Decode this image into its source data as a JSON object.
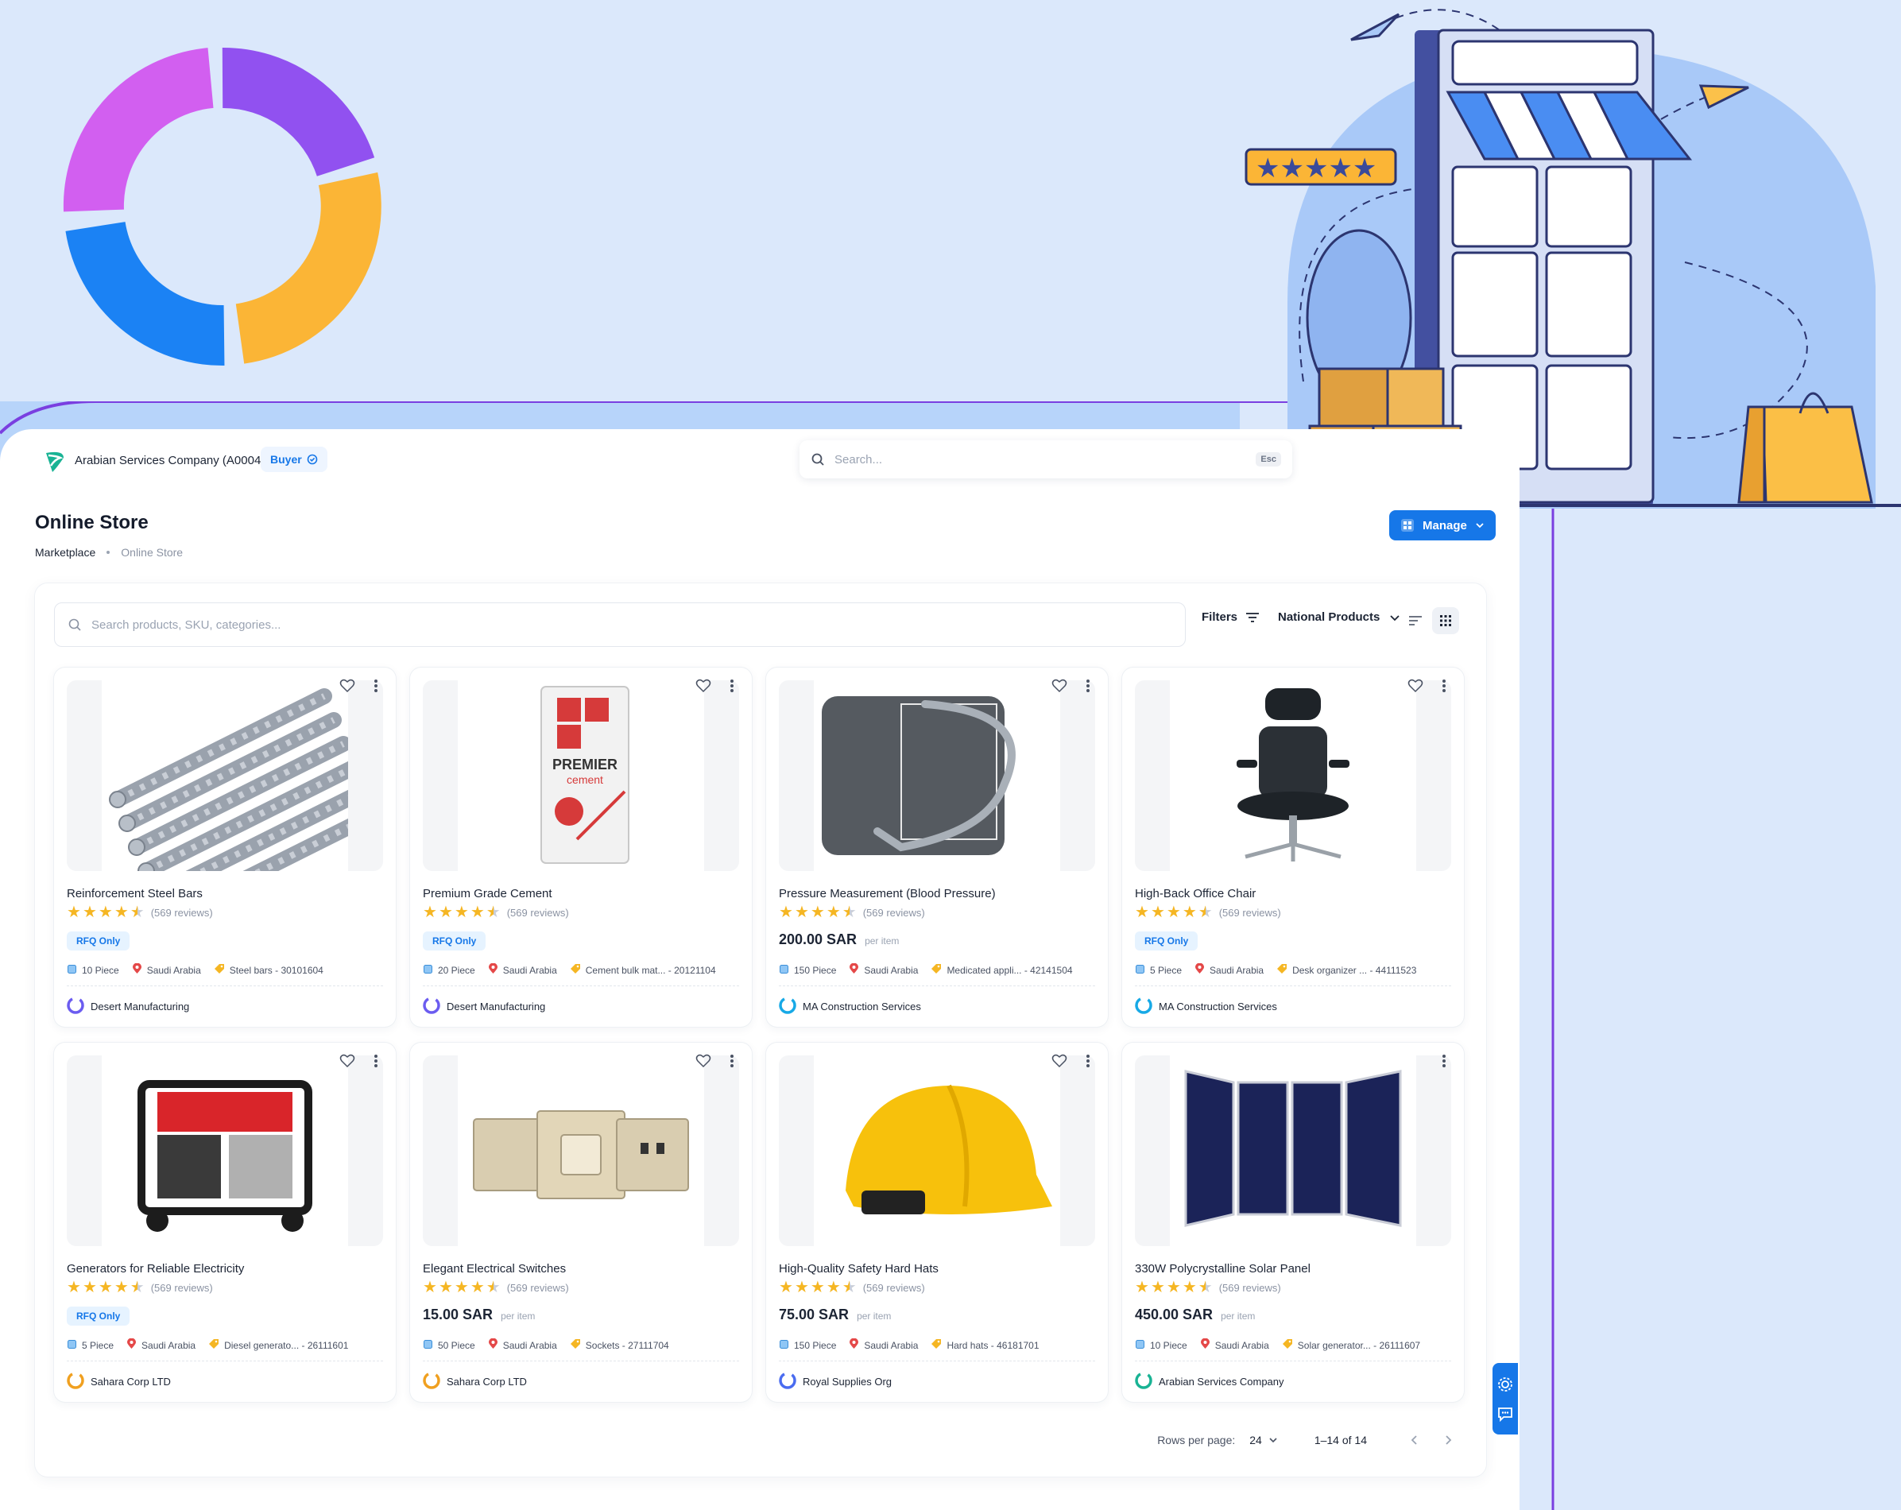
{
  "header": {
    "company": "Arabian Services Company (A0004)",
    "role_badge": "Buyer",
    "search_placeholder": "Search...",
    "esc_label": "Esc"
  },
  "page": {
    "title": "Online Store",
    "breadcrumb": [
      "Marketplace",
      "Online Store"
    ],
    "manage_label": "Manage"
  },
  "toolbar": {
    "search_placeholder": "Search products, SKU, categories...",
    "filters_label": "Filters",
    "scope_label": "National Products"
  },
  "products": [
    {
      "name": "Reinforcement Steel Bars",
      "reviews": "(569 reviews)",
      "rating": 4.5,
      "rfq": "RFQ Only",
      "price": "",
      "unit": "",
      "qty": "10 Piece",
      "country": "Saudi Arabia",
      "category": "Steel bars - 30101604",
      "vendor": "Desert Manufacturing",
      "vendor_color": "#6b5cf0",
      "image": "steel",
      "favorite": true
    },
    {
      "name": "Premium Grade Cement",
      "reviews": "(569 reviews)",
      "rating": 4.5,
      "rfq": "RFQ Only",
      "price": "",
      "unit": "",
      "qty": "20 Piece",
      "country": "Saudi Arabia",
      "category": "Cement bulk mat... - 20121104",
      "vendor": "Desert Manufacturing",
      "vendor_color": "#6b5cf0",
      "image": "cement",
      "favorite": true
    },
    {
      "name": "Pressure Measurement (Blood Pressure)",
      "reviews": "(569 reviews)",
      "rating": 4.5,
      "rfq": "",
      "price": "200.00 SAR",
      "unit": "per item",
      "qty": "150 Piece",
      "country": "Saudi Arabia",
      "category": "Medicated appli... - 42141504",
      "vendor": "MA Construction Services",
      "vendor_color": "#17a9e6",
      "image": "cuff",
      "favorite": true
    },
    {
      "name": "High-Back Office Chair",
      "reviews": "(569 reviews)",
      "rating": 4.5,
      "rfq": "RFQ Only",
      "price": "",
      "unit": "",
      "qty": "5 Piece",
      "country": "Saudi Arabia",
      "category": "Desk organizer ... - 44111523",
      "vendor": "MA Construction Services",
      "vendor_color": "#17a9e6",
      "image": "chair",
      "favorite": true
    },
    {
      "name": "Generators for Reliable Electricity",
      "reviews": "(569 reviews)",
      "rating": 4.5,
      "rfq": "RFQ Only",
      "price": "",
      "unit": "",
      "qty": "5 Piece",
      "country": "Saudi Arabia",
      "category": "Diesel generato... - 26111601",
      "vendor": "Sahara Corp LTD",
      "vendor_color": "#f0a020",
      "image": "generator",
      "favorite": true
    },
    {
      "name": "Elegant Electrical Switches",
      "reviews": "(569 reviews)",
      "rating": 4.5,
      "rfq": "",
      "price": "15.00 SAR",
      "unit": "per item",
      "qty": "50 Piece",
      "country": "Saudi Arabia",
      "category": "Sockets - 27111704",
      "vendor": "Sahara Corp LTD",
      "vendor_color": "#f0a020",
      "image": "switch",
      "favorite": true
    },
    {
      "name": "High-Quality Safety Hard Hats",
      "reviews": "(569 reviews)",
      "rating": 4.5,
      "rfq": "",
      "price": "75.00 SAR",
      "unit": "per item",
      "qty": "150 Piece",
      "country": "Saudi Arabia",
      "category": "Hard hats - 46181701",
      "vendor": "Royal Supplies Org",
      "vendor_color": "#4a6cf0",
      "image": "hardhat",
      "favorite": true
    },
    {
      "name": "330W Polycrystalline Solar Panel",
      "reviews": "(569 reviews)",
      "rating": 4.5,
      "rfq": "",
      "price": "450.00 SAR",
      "unit": "per item",
      "qty": "10 Piece",
      "country": "Saudi Arabia",
      "category": "Solar generator... - 26111607",
      "vendor": "Arabian Services Company",
      "vendor_color": "#19b394",
      "image": "solar",
      "favorite": false
    }
  ],
  "pagination": {
    "rows_label": "Rows per page:",
    "rows_value": "24",
    "range": "1–14 of 14"
  },
  "colors": {
    "accent": "#1677e8",
    "star": "#f5b623",
    "background": "#dbe8fb"
  }
}
